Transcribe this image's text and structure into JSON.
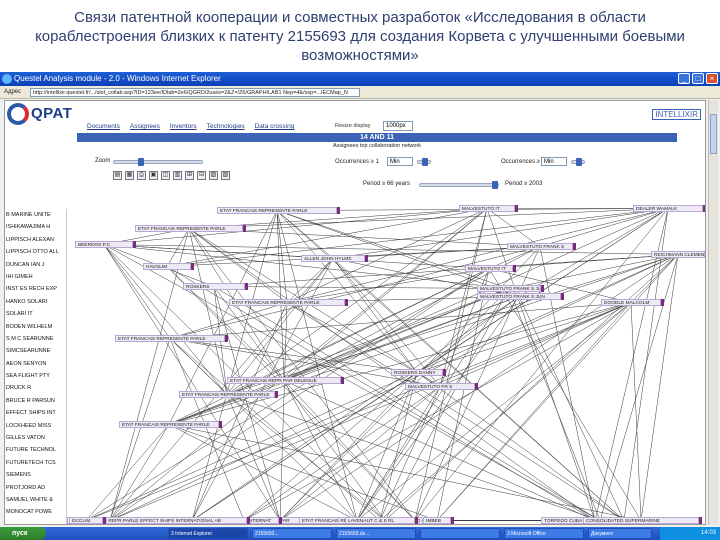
{
  "slide": {
    "title": "Связи патентной кооперации и совместных разработок «Исследования в области кораблестроения близких к патенту 2155693 для создания Корвета с улучшенными боевыми возможностями»"
  },
  "browser": {
    "title": "Questel Analysis module - 2.0 - Windows Internet Explorer",
    "address_label": "Адрес",
    "address": "http://intellixir.questel.fr/.../slot_collab.asp?ID=123ee/IDlab=2e6/QGRD/2uses=2&Z=/Z6/GRAPH/LAB1 Nep=4&/ssp=...IECMap_N"
  },
  "app": {
    "logo_text": "QPAT",
    "brand": "INTELLIXIR",
    "menu": [
      "Documents",
      "Assignees",
      "Inventors",
      "Technologies",
      "Data crossing"
    ],
    "resize_label": "Resize display",
    "resize_value": "1000px",
    "banner": "14 AND 11",
    "subtitle": "Assignees top collaboration network",
    "zoom_label": "Zoom",
    "toolbar_icons": [
      "▤",
      "▦",
      "⎙",
      "▣",
      "◫",
      "▥",
      "⊞",
      "⊟",
      "▧",
      "▨"
    ],
    "controls": [
      {
        "label": "Occurrences ≥ 1",
        "value": "Min"
      },
      {
        "label": "Occurrences ≥ 1",
        "value": "Min"
      },
      {
        "label": "Period ≥ 66 years",
        "value": ""
      },
      {
        "label": "Period ≥ 2003",
        "value": ""
      }
    ]
  },
  "left_list": [
    "B MARINE UNITE",
    "ISHIKAWAJIMA H",
    "LIPPISCH ALEXAN",
    "LIPPISCH OTTO ALL",
    "DUNCAN IAN J",
    "IHI GIMEH",
    "INST ES RECH EXP",
    "HANKO SOLARI",
    "SOLARI IT",
    "BODEN WILHELM",
    "S M C SEARUNNE",
    "SIMCSEARUNNE",
    "AEON SENYON",
    "SEA FLIGHT PTY",
    "DRUCK R",
    "BRUCE R PARSUN",
    "EFFECT SHIPS INT",
    "LOCKHEED MISS",
    "GILLES VATON",
    "FUTURE TECHNOL",
    "FUTURETECH TCS",
    "SIEMENS",
    "PROTJORD AD",
    "SAMUEL WHITE &",
    "MONOCAT POWE"
  ],
  "nodes": [
    "ETAT FRANCAIS REPRESENTE PARLE",
    "ETAT FRANCAIS REPRESENTE PARLE",
    "ETAT FRANCAIS REPRESENTE PARLE",
    "ETAT FRANCAIS REPRESENTE PARLE",
    "ETAT FRANCAIS REPRESENTE PARLE",
    "ETAT FRANCAIS REPRESENTE PARLE",
    "ETAT FRANCAIS REPR PAR DELEGUE",
    "ETAT FRANCAIS REPRESENTE PAR",
    "ETAT FRANCAIS REPR PARLE",
    "ETAT FRANCAIS REPRESENTE PAR LE",
    "ALLEN JOHN HYLMS",
    "MALVESTUTO FRANK S",
    "MALVESTUTO FRANK S JUN",
    "MALVESTUTO IT",
    "MALVESTUTO FR S",
    "MALVESTUTO FRANK S JUN",
    "MALVESTUTO IT",
    "BEERDOS P.C.",
    "DOODLE MALCOLM",
    "DOODLE MALCOLM",
    "DEALER WAMALK",
    "DEALER WAMALK",
    "REICHMANN CLEMENS",
    "REICHMANN CLEMENS",
    "ROSKERS DANNY",
    "ROSKERS DANNY",
    "HAVOLIM",
    "ROSKERS",
    "DCCLIM",
    "EFFECT SHIPS INTERNAT",
    "EFFECT SHIPS INTERNATIONAL AB",
    "PROFJORD AB",
    "KOCT",
    "IMBEB",
    "LAVENAUT C & S RL",
    "BERNTSYIN ANATOLIEVICH ANDREI",
    "ANDREI ANATOLIEVICH BERNTSYIN",
    "TORPEDO CUBA LATA ANTONIO KOVEN",
    "CONSOLIDATED SUPERMARINE"
  ],
  "taskbar": {
    "start": "пуск",
    "tasks": [
      "3 Internet Explorer",
      "2155693...",
      "2155693.ds...",
      "",
      "3 Microsoft Office",
      "Документ"
    ],
    "clock": "14:03"
  }
}
